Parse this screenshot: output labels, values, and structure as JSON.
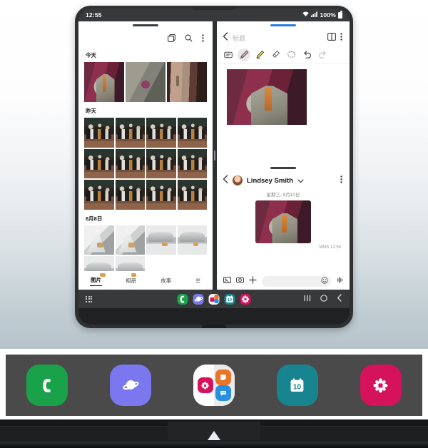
{
  "background": {
    "gradient_top": "#ffffff",
    "gradient_bottom": "#b6c3ca"
  },
  "device": {
    "frame_color": "#2e3032",
    "status_bar": {
      "time": "12:55",
      "battery_percent": "100%",
      "icons": [
        "wifi-icon",
        "signal-icon",
        "battery-icon"
      ]
    }
  },
  "gallery_app": {
    "handle_color": "#3b3e41",
    "topbar_icons": [
      "multi-select-icon",
      "search-icon",
      "more-options-icon"
    ],
    "sections": [
      {
        "label": "今天",
        "columns": 3,
        "photos": [
          "ph-suit",
          "ph-fabric",
          "ph-ties"
        ]
      },
      {
        "label": "昨天",
        "columns": 4,
        "photos": [
          "ph-crowd",
          "ph-crowd",
          "ph-crowd",
          "ph-crowd",
          "ph-crowd",
          "ph-crowd",
          "ph-crowd",
          "ph-crowd",
          "ph-crowd",
          "ph-crowd",
          "ph-crowd",
          "ph-crowd"
        ]
      },
      {
        "label": "8月8日",
        "columns": 4,
        "photos": [
          "ph-cone",
          "ph-cone",
          "ph-print",
          "ph-print",
          "ph-print",
          "ph-print"
        ]
      }
    ],
    "tabs": [
      {
        "label": "图片",
        "active": true
      },
      {
        "label": "相册",
        "active": false
      },
      {
        "label": "故事",
        "active": false
      },
      {
        "label": "☰",
        "active": false
      }
    ]
  },
  "notes_app": {
    "handle_color": "#2a7ae2",
    "accent": "#2a7ae2",
    "back_icon": "back-chevron-icon",
    "title_placeholder": "标题",
    "right_icons": [
      "split-view-icon",
      "more-options-icon"
    ],
    "tools": [
      {
        "name": "text-keyboard-tool",
        "glyph": "keyboard",
        "selected": false
      },
      {
        "name": "pen-tool",
        "glyph": "pen",
        "selected": true
      },
      {
        "name": "highlighter-tool",
        "glyph": "highlighter",
        "selected": false
      },
      {
        "name": "eraser-tool",
        "glyph": "eraser",
        "selected": false
      },
      {
        "name": "lasso-select-tool",
        "glyph": "lasso",
        "selected": false
      },
      {
        "name": "undo-tool",
        "glyph": "undo",
        "selected": false
      },
      {
        "name": "redo-tool",
        "glyph": "redo",
        "selected": false
      }
    ],
    "canvas_image": "gray-suit-on-mannequin"
  },
  "messages_app": {
    "back_icon": "back-chevron-icon",
    "contact_name": "Lindsey Smith",
    "dropdown_icon": "chevron-down-icon",
    "more_icon": "more-options-icon",
    "date_divider": "星期三, 8月10日",
    "message": {
      "type": "image",
      "image": "gray-suit-on-mannequin",
      "meta": "MMS 12:55"
    },
    "input_bar": {
      "placeholder": "",
      "left_icons": [
        "gallery-icon",
        "camera-icon",
        "add-plus-icon"
      ],
      "right_icons": [
        "emoji-icon",
        "voice-input-icon"
      ]
    }
  },
  "taskbar": {
    "background": "#37393b",
    "apps_button": "all-apps-grid-icon",
    "apps": [
      {
        "name": "phone-app-icon",
        "label": "Phone",
        "color": "#1aa24a"
      },
      {
        "name": "internet-app-icon",
        "label": "Internet",
        "color": "#7b78ef"
      },
      {
        "name": "folder-app-icon",
        "label": "Folder",
        "color": "#f4f4f4"
      },
      {
        "name": "calendar-app-icon",
        "label": "Calendar",
        "color": "#17848f",
        "day": "10"
      },
      {
        "name": "gallery-app-icon",
        "label": "Gallery",
        "color": "#d5125c"
      }
    ],
    "nav": [
      "recents-button",
      "home-button",
      "back-button"
    ]
  },
  "dock_strip": {
    "background": "#4a4a4a",
    "apps": [
      {
        "name": "phone-app-icon",
        "color": "#1aa24a"
      },
      {
        "name": "internet-app-icon",
        "color": "#7b78ef"
      },
      {
        "name": "folder-app-icon",
        "color": "#f4f4f4",
        "contains": [
          "gallery-app-icon",
          "notes-app-icon",
          "messages-app-icon"
        ]
      },
      {
        "name": "calendar-app-icon",
        "color": "#17848f",
        "day": "10"
      },
      {
        "name": "gallery-app-icon",
        "color": "#d5125c"
      }
    ]
  },
  "hardware_edge": {
    "color": "#17181a",
    "hinge": "device-hinge"
  }
}
